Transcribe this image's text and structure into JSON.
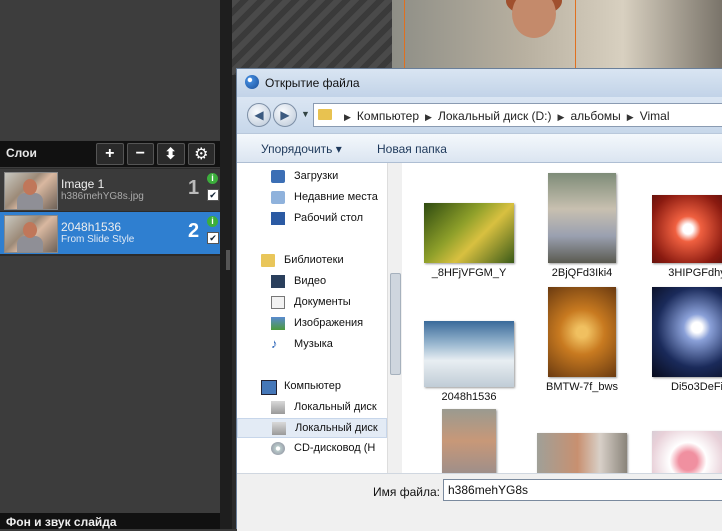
{
  "layers_panel": {
    "title": "Слои",
    "tools": [
      "+",
      "−",
      "⬍",
      "⚙"
    ],
    "layers": [
      {
        "name": "Image 1",
        "sub": "h386mehYG8s.jpg",
        "num": "1"
      },
      {
        "name": "2048h1536",
        "sub": "From Slide Style",
        "num": "2"
      }
    ],
    "bottom_title": "Фон и звук слайда"
  },
  "dialog": {
    "title": "Открытие файла",
    "breadcrumbs": [
      "Компьютер",
      "Локальный диск (D:)",
      "альбомы",
      "Vimal"
    ],
    "toolbar": {
      "organize": "Упорядочить ▾",
      "new_folder": "Новая папка"
    },
    "nav": [
      {
        "label": "Загрузки",
        "icon": "downloads-icon"
      },
      {
        "label": "Недавние места",
        "icon": "recent-places-icon"
      },
      {
        "label": "Рабочий стол",
        "icon": "desktop-icon"
      },
      {
        "label": "Библиотеки",
        "icon": "libraries-icon"
      },
      {
        "label": "Видео",
        "icon": "video-icon"
      },
      {
        "label": "Документы",
        "icon": "documents-icon"
      },
      {
        "label": "Изображения",
        "icon": "pictures-icon"
      },
      {
        "label": "Музыка",
        "icon": "music-icon"
      },
      {
        "label": "Компьютер",
        "icon": "computer-icon"
      },
      {
        "label": "Локальный диск",
        "icon": "local-disk-icon"
      },
      {
        "label": "Локальный диск",
        "icon": "local-disk-icon"
      },
      {
        "label": "CD-дисковод (H",
        "icon": "cd-drive-icon"
      }
    ],
    "files": [
      {
        "label": "_8HFjVFGM_Y"
      },
      {
        "label": "2BjQFd3Iki4"
      },
      {
        "label": "3HIPGFdhy"
      },
      {
        "label": "2048h1536"
      },
      {
        "label": "BMTW-7f_bws"
      },
      {
        "label": "Di5o3DeFi"
      },
      {
        "label": ""
      },
      {
        "label": ""
      },
      {
        "label": ""
      }
    ],
    "filename_label": "Имя файла:",
    "filename_value": "h386mehYG8s"
  }
}
